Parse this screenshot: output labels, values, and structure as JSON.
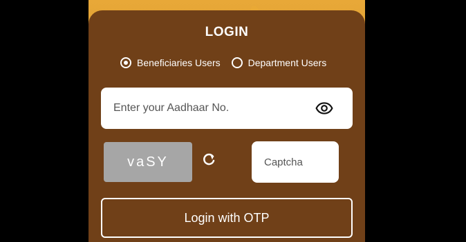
{
  "login": {
    "title": "LOGIN",
    "radio_options": [
      {
        "label": "Beneficiaries Users",
        "selected": true
      },
      {
        "label": "Department Users",
        "selected": false
      }
    ],
    "aadhaar_placeholder": "Enter your Aadhaar No.",
    "captcha_text": "vaSY",
    "captcha_placeholder": "Captcha",
    "otp_button_label": "Login with OTP"
  },
  "icons": {
    "password_toggle": "eye-icon",
    "refresh": "refresh-icon"
  },
  "colors": {
    "card_background": "#704018",
    "header_background": "#e8a838",
    "captcha_background": "#a6a6a6",
    "text": "#ffffff"
  }
}
